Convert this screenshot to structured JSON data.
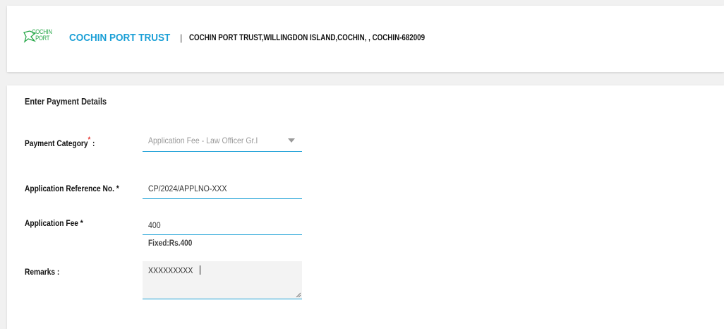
{
  "header": {
    "logo_line1": "COCHIN",
    "logo_line2": "PORT",
    "brand_name": "COCHIN PORT TRUST",
    "separator": "|",
    "address": "COCHIN PORT TRUST,WILLINGDON ISLAND,COCHIN, , COCHIN-682009"
  },
  "form": {
    "section_title": "Enter Payment Details",
    "payment_category": {
      "label": "Payment Category",
      "required_mark": "*",
      "colon": ":",
      "value": "Application Fee - Law Officer Gr.I"
    },
    "application_reference": {
      "label": "Application Reference No. *",
      "value": "CP/2024/APPLNO-XXX"
    },
    "application_fee": {
      "label": "Application Fee *",
      "value": "400",
      "hint": "Fixed:Rs.400"
    },
    "remarks": {
      "label": "Remarks :",
      "value": "XXXXXXXXX"
    }
  },
  "colors": {
    "accent": "#1a9fd6",
    "logo_green": "#28a84a",
    "required": "#e53935"
  },
  "icons": {
    "logo": "cochin-port-logo-icon",
    "dropdown": "chevron-down-icon",
    "resize": "resize-handle-icon"
  }
}
